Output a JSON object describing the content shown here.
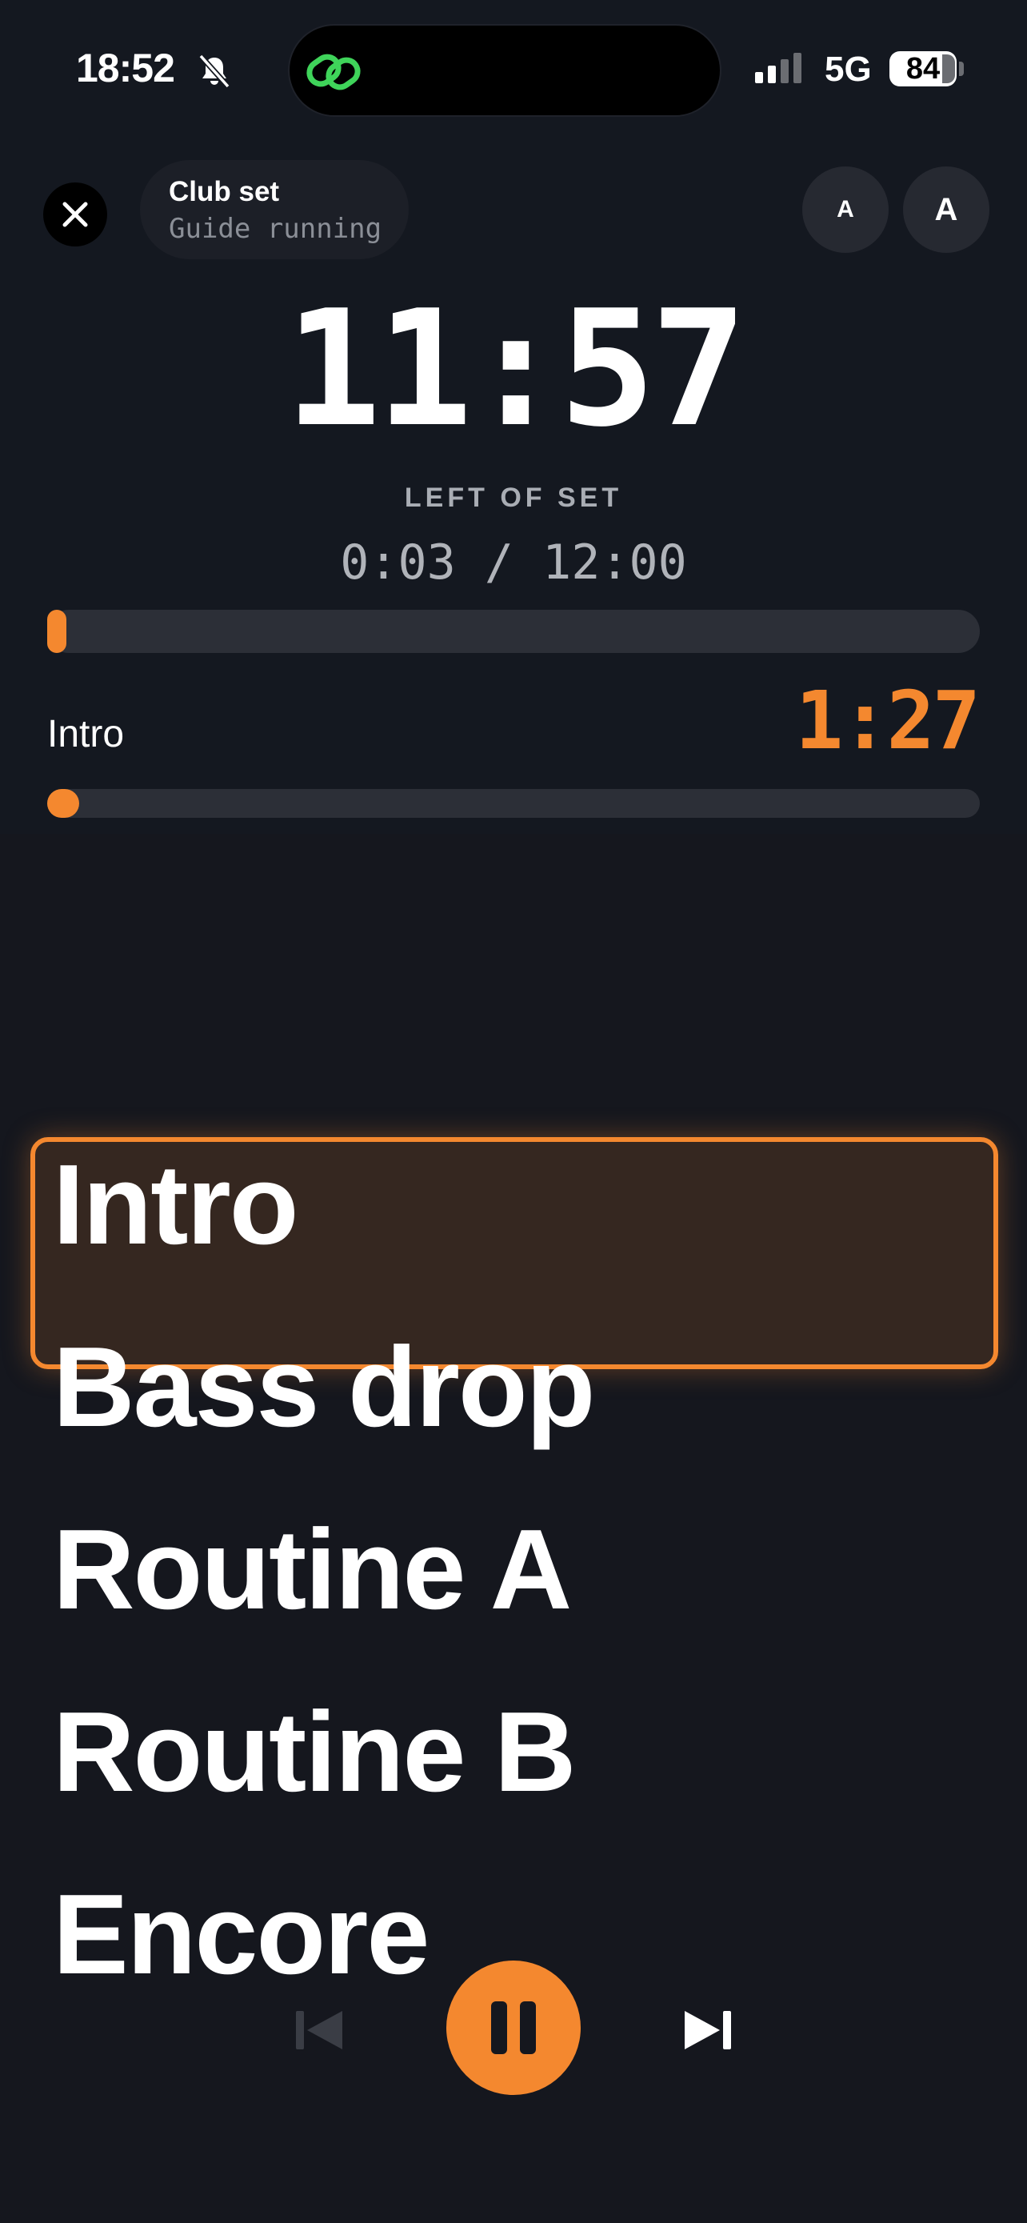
{
  "status_bar": {
    "time": "18:52",
    "network": "5G",
    "battery": "84",
    "icons": [
      "bell-slash-icon",
      "link-icon",
      "cellular-signal-icon"
    ]
  },
  "header": {
    "set_title": "Club set",
    "set_status": "Guide running",
    "font_small_label": "A",
    "font_large_label": "A"
  },
  "timer": {
    "remaining": "11:57",
    "remaining_caption": "LEFT OF SET",
    "elapsed": "0:03 / 12:00",
    "set_progress": 0.004
  },
  "current_section": {
    "name": "Intro",
    "remaining": "1:27",
    "progress": 0.034
  },
  "sections": [
    "Intro",
    "Bass drop",
    "Routine A",
    "Routine B",
    "Encore"
  ],
  "active_section_index": 0,
  "transport": {
    "prev_icon": "skip-previous-icon",
    "play_pause_icon": "pause-icon",
    "next_icon": "skip-next-icon",
    "prev_enabled": false
  },
  "colors": {
    "accent": "#f4882f",
    "background": "#15171e",
    "track": "#2c2f37",
    "island_icon": "#3fd45a"
  }
}
